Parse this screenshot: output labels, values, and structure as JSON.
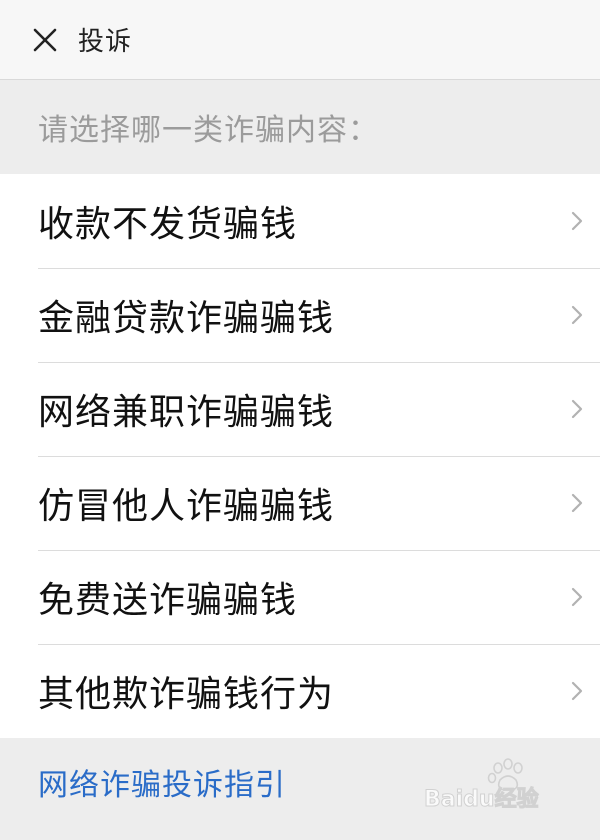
{
  "header": {
    "title": "投诉",
    "close_icon": "close-icon"
  },
  "section": {
    "prompt": "请选择哪一类诈骗内容："
  },
  "list": {
    "items": [
      {
        "label": "收款不发货骗钱"
      },
      {
        "label": "金融贷款诈骗骗钱"
      },
      {
        "label": "网络兼职诈骗骗钱"
      },
      {
        "label": "仿冒他人诈骗骗钱"
      },
      {
        "label": "免费送诈骗骗钱"
      },
      {
        "label": "其他欺诈骗钱行为"
      }
    ],
    "chevron_icon": "chevron-right-icon"
  },
  "footer": {
    "link_label": "网络诈骗投诉指引"
  },
  "watermark": {
    "text": "Baidu经验",
    "icon": "baidu-paw-logo"
  },
  "colors": {
    "background": "#ededed",
    "header_bg": "#f7f7f7",
    "list_bg": "#ffffff",
    "link": "#2a6cc8",
    "muted_text": "#9b9b9b",
    "divider": "#dcdcdc"
  }
}
